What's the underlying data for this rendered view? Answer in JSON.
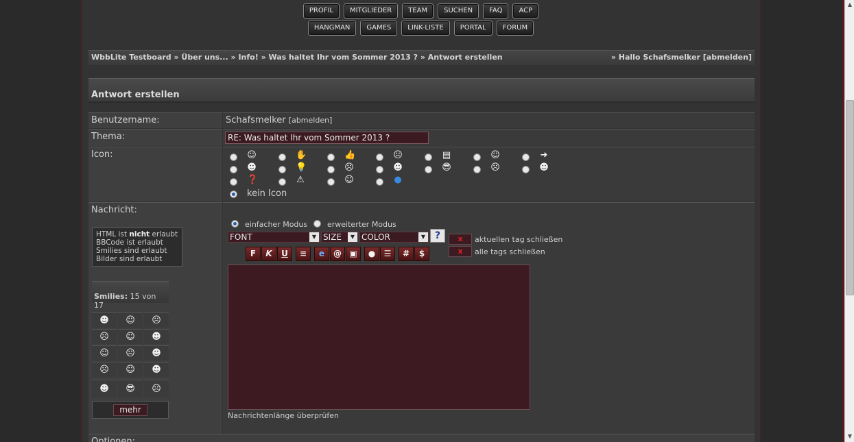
{
  "nav_row1": [
    "PROFIL",
    "MITGLIEDER",
    "TEAM",
    "SUCHEN",
    "FAQ",
    "ACP"
  ],
  "nav_row2": [
    "HANGMAN",
    "GAMES",
    "LINK-LISTE",
    "PORTAL",
    "FORUM"
  ],
  "breadcrumb": {
    "path": "WbbLite Testboard » Über uns... » Info! » Was haltet Ihr vom Sommer 2013 ? » Antwort erstellen",
    "greeting": "» Hallo Schafsmelker [abmelden]"
  },
  "form": {
    "title": "Antwort erstellen",
    "username_label": "Benutzername:",
    "username": "Schafsmelker",
    "logout_link": "[abmelden]",
    "thema_label": "Thema:",
    "thema_value": "RE: Was haltet Ihr vom Sommer 2013 ?",
    "icon_label": "Icon:",
    "no_icon_label": "kein Icon",
    "message_label": "Nachricht:",
    "options_label": "Optionen:"
  },
  "info_box": {
    "html_prefix": "HTML ist ",
    "html_bold": "nicht",
    "html_suffix": " erlaubt",
    "bbcode": "BBCode ist erlaubt",
    "smilies": "Smilies sind erlaubt",
    "images": "Bilder sind erlaubt"
  },
  "smilies": {
    "head_label": "Smilies:",
    "count": "15 von 17",
    "more_button": "mehr"
  },
  "editor": {
    "mode_simple": "einfacher Modus",
    "mode_advanced": "erweiterter Modus",
    "font_select": "FONT",
    "size_select": "SIZE",
    "color_select": "COLOR",
    "help_glyph": "?",
    "close_current_label": "aktuellen tag schließen",
    "close_all_label": "alle tags schließen",
    "close_glyph": "x",
    "toolbar": [
      "F",
      "K",
      "U",
      "≡",
      "e",
      "@",
      "▣",
      "●",
      "☰",
      "#",
      "$"
    ],
    "check_length": "Nachrichtenlänge überprüfen"
  }
}
